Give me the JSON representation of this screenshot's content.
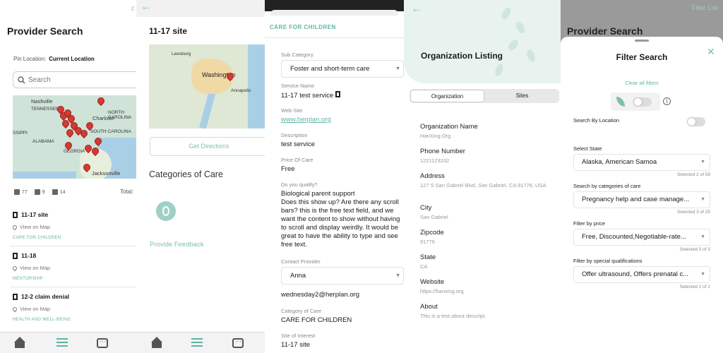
{
  "provider_search": {
    "title": "Provider Search",
    "filter_peek": "F",
    "pin_location_label": "Pin Location:",
    "pin_location_value": "Current Location",
    "search_placeholder": "Search",
    "map_labels": [
      "Nashville",
      "TENNESSEE",
      "Charlotte",
      "NORTH CAROLINA",
      "SOUTH CAROLINA",
      "ALABAMA",
      "GEORGIA",
      "SSIPPI",
      "Jacksonville"
    ],
    "stats": [
      "77",
      "9",
      "14"
    ],
    "total_label": "Total:",
    "results": [
      {
        "name": "11-17 site",
        "map_link": "View on Map",
        "category": "CARE FOR CHILDREN"
      },
      {
        "name": "11-18",
        "map_link": "View on Map",
        "category": "MENTORSHIP"
      },
      {
        "name": "12-2 claim denial",
        "map_link": "View on Map",
        "category": "HEALTH AND WELL-BEING"
      }
    ]
  },
  "site_detail": {
    "title": "11-17 site",
    "map_labels": [
      "Leesburg",
      "Washington",
      "Annapolis"
    ],
    "directions_button": "Get Directions",
    "categories_heading": "Categories of Care",
    "feedback_link": "Provide Feedback"
  },
  "care_detail": {
    "header": "CARE FOR CHILDREN",
    "sub_category_label": "Sub Category",
    "sub_category_value": "Foster and short-term care",
    "service_name_label": "Service Name",
    "service_name_value": "11-17 test service",
    "web_site_label": "Web Site",
    "web_site_value": "www.herplan.org",
    "description_label": "Description",
    "description_value": "test service",
    "price_label": "Price Of Care",
    "price_value": "Free",
    "qualify_label": "Do you qualify?",
    "qualify_value": "Biological parent support",
    "free_text": "Does this show up? Are there any scroll bars? this is the free text field, and we want the content to show without having to scroll and display weirdly. It would be great to have the ability to type and see free text.",
    "contact_label": "Contact Provider",
    "contact_value": "Anna",
    "contact_email": "wednesday2@herplan.org",
    "category_label": "Category of Care",
    "category_value": "CARE FOR CHILDREN",
    "site_label": "Site of Interest",
    "site_value": "11-17 site"
  },
  "org_listing": {
    "title": "Organization Listing",
    "tabs": [
      "Organization",
      "Sites"
    ],
    "fields": [
      {
        "label": "Organization Name",
        "value": "HanXing Org"
      },
      {
        "label": "Phone Number",
        "value": "1221123332"
      },
      {
        "label": "Address",
        "value": "127 S San Gabriel Blvd, San Gabriel, CA 91776, USA"
      },
      {
        "label": "City",
        "value": "San Gabriel"
      },
      {
        "label": "Zipcode",
        "value": "91776"
      },
      {
        "label": "State",
        "value": "CA"
      },
      {
        "label": "Website",
        "value": "https://hanxing.org"
      },
      {
        "label": "About",
        "value": "This is a test about descript."
      }
    ]
  },
  "filter_search": {
    "peek_title": "Provider Search",
    "peek_filter": "Filter List",
    "title": "Filter Search",
    "clear_all": "Clear all filters",
    "search_by_location": "Search By Location",
    "filters": [
      {
        "label": "Select State",
        "value": "Alaska, American Samoa",
        "selected": "Selected 2 of 59"
      },
      {
        "label": "Search by categories of care",
        "value": "Pregnancy help and case manage...",
        "selected": "Selected 3 of 25"
      },
      {
        "label": "Filter by price",
        "value": "Free, Discounted,Negotiable-rate...",
        "selected": "Selected 3 of 5"
      },
      {
        "label": "Filter by special qualifications",
        "value": "Offer ultrasound, Offers prenatal c...",
        "selected": "Selected 2 of 2"
      }
    ]
  },
  "colors": {
    "accent": "#5fb3a3",
    "pin": "#d43a33"
  }
}
